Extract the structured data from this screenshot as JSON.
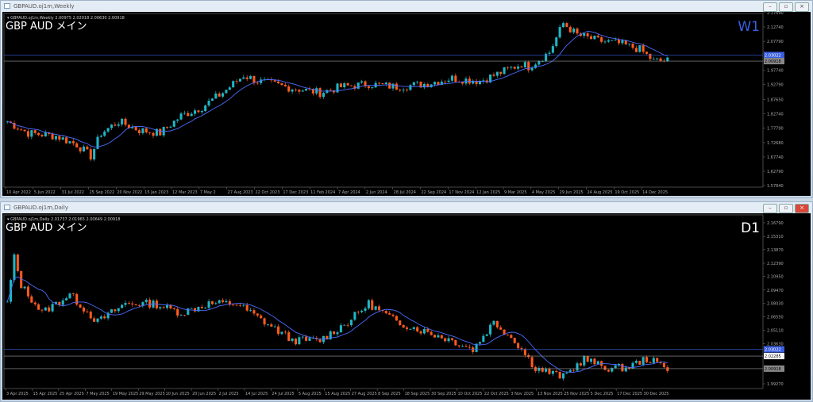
{
  "colors": {
    "bull": "#1fb6c6",
    "bear": "#ff5a1e",
    "ma": "#4c6dff",
    "grid": "#777",
    "bg": "#000"
  },
  "weekly": {
    "window_title": "GBPAUD.oj1m,Weekly",
    "ohlc_line": "GBPAUD.oj1m,Weekly  2.00975 2.02018 2.00630 2.00918",
    "label": "GBP AUD メイン",
    "timeframe": "W1",
    "price_ticks": [
      "2.17690",
      "2.12740",
      "2.07790",
      "1.97740",
      "1.92790",
      "1.87650",
      "1.82740",
      "1.77790",
      "1.72680",
      "1.67740",
      "1.62790",
      "1.57840"
    ],
    "blue_marker": "2.03022",
    "gray_marker": "2.00918",
    "date_ticks": [
      "10 Apr 2022",
      "5 Jun 2022",
      "31 Jul 2022",
      "25 Sep 2022",
      "20 Nov 2022",
      "15 Jan 2023",
      "12 Mar 2023",
      "7 May 2",
      "27 Aug 2023",
      "22 Oct 2023",
      "17 Dec 2023",
      "11 Feb 2024",
      "7 Apr 2024",
      "2 Jun 2024",
      "28 Jul 2024",
      "22 Sep 2024",
      "17 Nov 2024",
      "12 Jan 2025",
      "9 Mar 2025",
      "4 May 2025",
      "29 Jun 2025",
      "24 Aug 2025",
      "19 Oct 2025",
      "14 Dec 2025"
    ]
  },
  "daily": {
    "window_title": "GBPAUD.oj1m,Daily",
    "ohlc_line": "GBPAUD.oj1m,Daily  2.01737 2.01965 2.00649 2.00918",
    "label": "GBP AUD メイン",
    "timeframe": "D1",
    "price_ticks": [
      "2.16790",
      "2.15310",
      "2.13870",
      "2.12390",
      "2.10950",
      "2.09470",
      "2.08030",
      "2.06550",
      "2.05110",
      "2.03630",
      "1.99270"
    ],
    "blue_marker": "2.03022",
    "white_marker": "2.02285",
    "gray_marker": "2.00918",
    "date_ticks": [
      "3 Apr 2025",
      "15 Apr 2025",
      "25 Apr 2025",
      "7 May 2025",
      "19 May 2025",
      "29 May 2025",
      "10 Jun 2025",
      "20 Jun 2025",
      "2 Jul 2025",
      "14 Jul 2025",
      "24 Jul 2025",
      "5 Aug 2025",
      "15 Aug 2025",
      "27 Aug 2025",
      "8 Sep 2025",
      "18 Sep 2025",
      "30 Sep 2025",
      "10 Oct 2025",
      "22 Oct 2025",
      "3 Nov 2025",
      "13 Nov 2025",
      "25 Nov 2025",
      "5 Dec 2025",
      "17 Dec 2025",
      "30 Dec 2025"
    ]
  },
  "chart_data": [
    {
      "type": "candlestick",
      "title": "GBPAUD.oj1m,Weekly",
      "ylim": [
        1.5784,
        2.1769
      ],
      "moving_average": true,
      "approx_close_path": [
        [
          0,
          1.8
        ],
        [
          6,
          1.76
        ],
        [
          14,
          1.75
        ],
        [
          20,
          1.72
        ],
        [
          24,
          1.68
        ],
        [
          27,
          1.76
        ],
        [
          32,
          1.8
        ],
        [
          38,
          1.77
        ],
        [
          44,
          1.76
        ],
        [
          50,
          1.82
        ],
        [
          56,
          1.85
        ],
        [
          62,
          1.9
        ],
        [
          68,
          1.96
        ],
        [
          72,
          1.94
        ],
        [
          80,
          1.92
        ],
        [
          90,
          1.9
        ],
        [
          96,
          1.92
        ],
        [
          104,
          1.93
        ],
        [
          112,
          1.92
        ],
        [
          120,
          1.93
        ],
        [
          128,
          1.95
        ],
        [
          136,
          1.94
        ],
        [
          142,
          1.97
        ],
        [
          148,
          2.0
        ],
        [
          150,
          1.99
        ],
        [
          156,
          2.04
        ],
        [
          160,
          2.14
        ],
        [
          164,
          2.1
        ],
        [
          170,
          2.08
        ],
        [
          176,
          2.07
        ],
        [
          182,
          2.05
        ],
        [
          186,
          2.01
        ],
        [
          190,
          2.01
        ]
      ]
    },
    {
      "type": "candlestick",
      "title": "GBPAUD.oj1m,Daily",
      "ylim": [
        1.9927,
        2.1679
      ],
      "moving_average": true,
      "approx_close_path": [
        [
          0,
          2.08
        ],
        [
          2,
          2.13
        ],
        [
          4,
          2.1
        ],
        [
          10,
          2.07
        ],
        [
          18,
          2.09
        ],
        [
          26,
          2.06
        ],
        [
          34,
          2.08
        ],
        [
          42,
          2.08
        ],
        [
          50,
          2.07
        ],
        [
          58,
          2.08
        ],
        [
          66,
          2.08
        ],
        [
          74,
          2.06
        ],
        [
          82,
          2.04
        ],
        [
          90,
          2.04
        ],
        [
          98,
          2.06
        ],
        [
          104,
          2.08
        ],
        [
          112,
          2.06
        ],
        [
          120,
          2.05
        ],
        [
          128,
          2.04
        ],
        [
          134,
          2.03
        ],
        [
          140,
          2.06
        ],
        [
          146,
          2.04
        ],
        [
          152,
          2.01
        ],
        [
          160,
          2.0
        ],
        [
          166,
          2.02
        ],
        [
          172,
          2.01
        ],
        [
          178,
          2.01
        ],
        [
          184,
          2.02
        ],
        [
          190,
          2.01
        ]
      ]
    }
  ]
}
